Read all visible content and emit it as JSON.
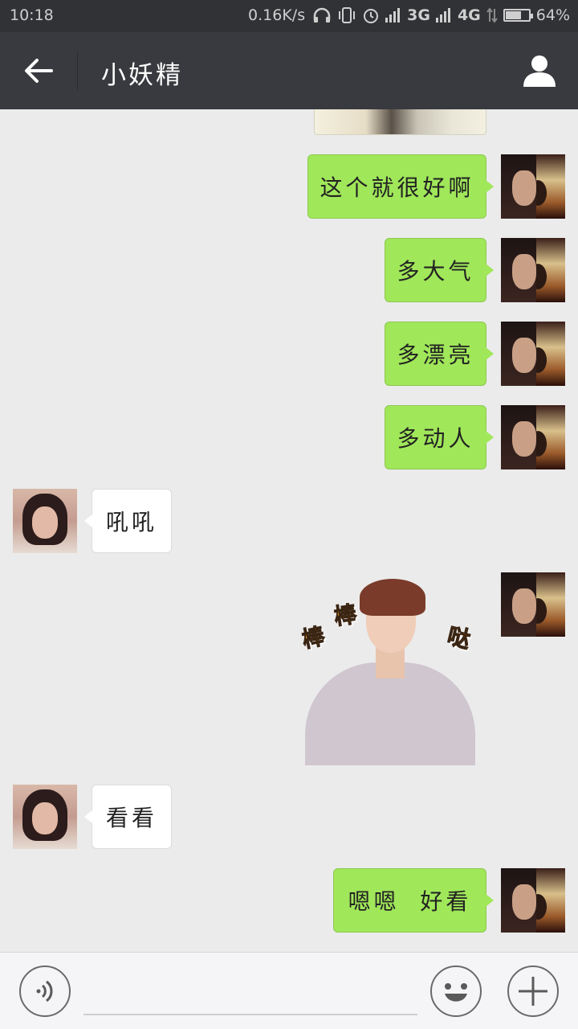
{
  "status_bar": {
    "time": "10:18",
    "net_speed": "0.16K/s",
    "network_1": "3G",
    "network_2": "4G",
    "battery": "64%",
    "battery_level": 0.64,
    "icons": [
      "headphones-icon",
      "vibrate-icon",
      "alarm-icon",
      "signal-icon",
      "signal-icon",
      "data-transfer-icon",
      "battery-icon"
    ]
  },
  "header": {
    "title": "小妖精",
    "back_icon": "arrow-left-icon",
    "profile_icon": "person-icon"
  },
  "messages": [
    {
      "from": "me",
      "text": "这个就很好啊"
    },
    {
      "from": "me",
      "text": "多大气"
    },
    {
      "from": "me",
      "text": "多漂亮"
    },
    {
      "from": "me",
      "text": "多动人"
    },
    {
      "from": "her",
      "text": "吼吼"
    },
    {
      "from": "me",
      "type": "sticker",
      "sticker_text": [
        "棒",
        "棒",
        "哒"
      ]
    },
    {
      "from": "her",
      "text": "看看"
    },
    {
      "from": "me",
      "text": "嗯嗯  好看"
    }
  ],
  "input_bar": {
    "voice_icon": "voice-icon",
    "emoji_icon": "emoji-icon",
    "plus_icon": "plus-icon",
    "placeholder": ""
  },
  "colors": {
    "status_bar": "#313236",
    "header": "#393a3f",
    "chat_bg": "#ebebeb",
    "my_bubble": "#a0e75a",
    "her_bubble": "#ffffff"
  }
}
